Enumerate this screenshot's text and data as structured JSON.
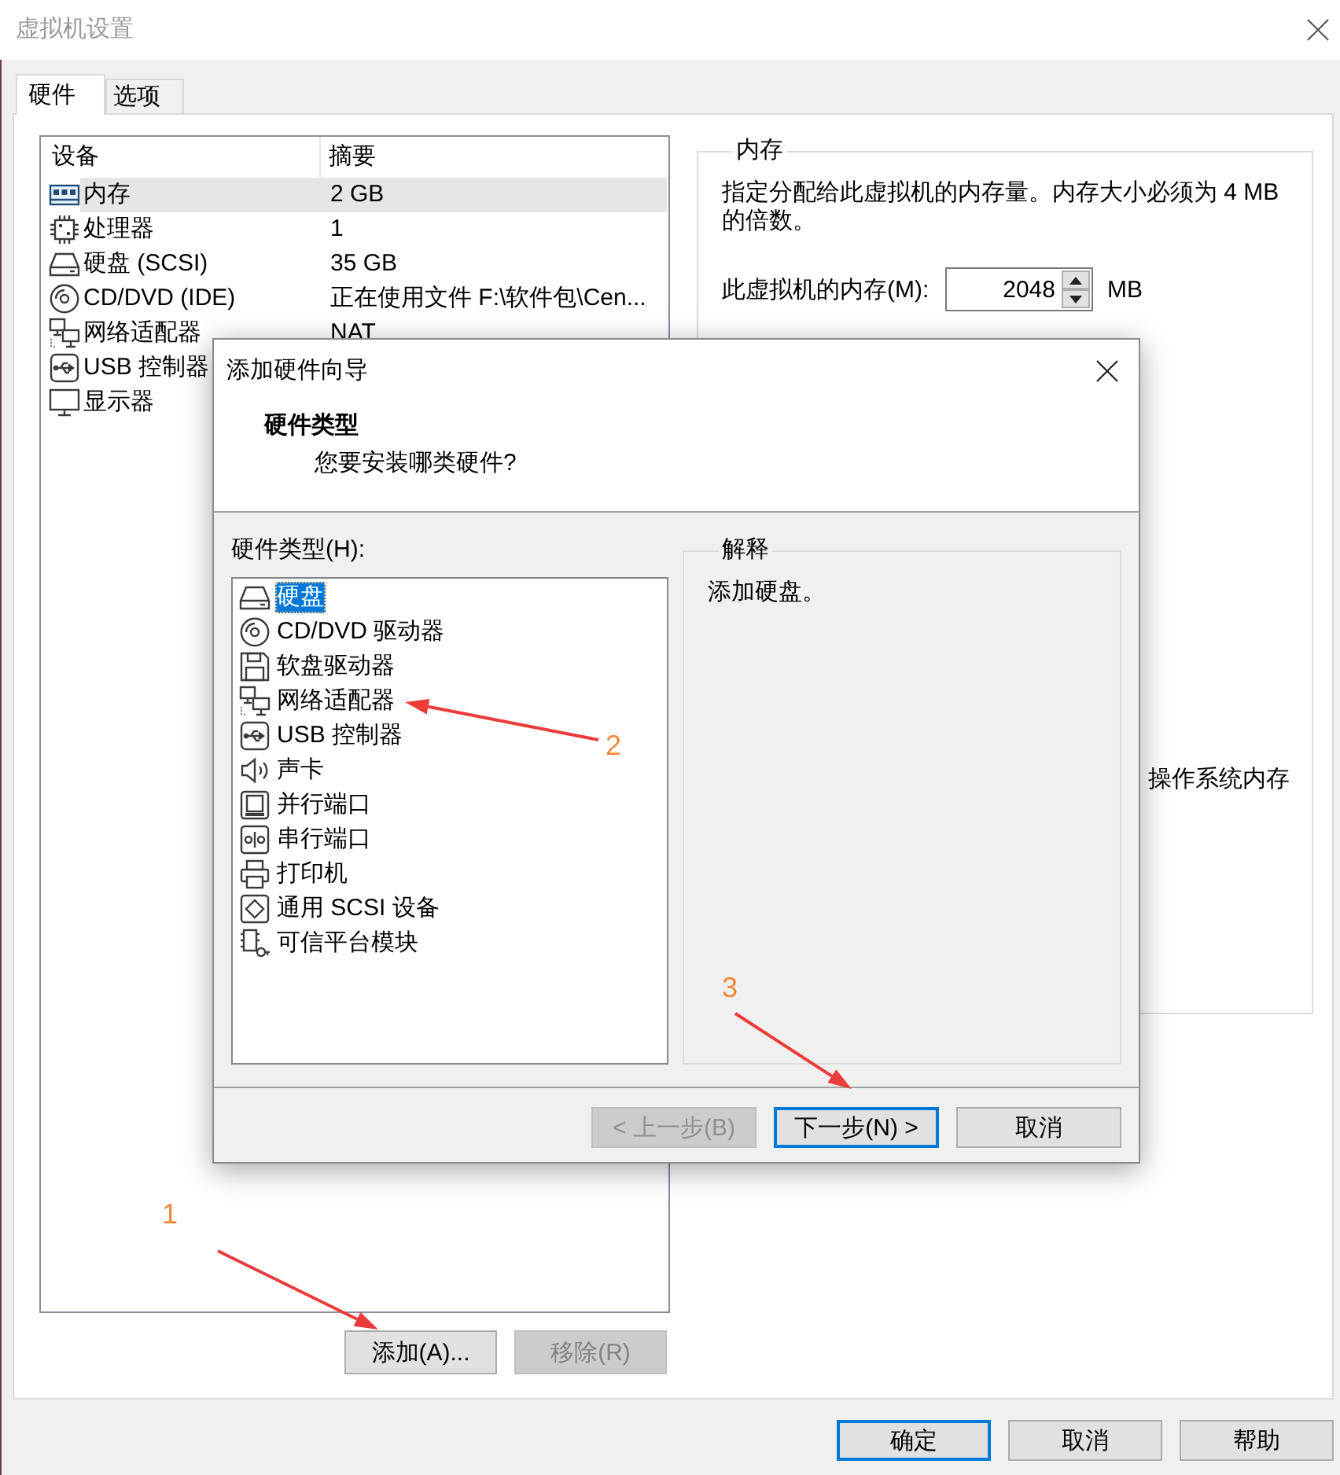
{
  "window": {
    "title": "虚拟机设置"
  },
  "tabs": [
    {
      "label": "硬件",
      "selected": true
    },
    {
      "label": "选项",
      "selected": false
    }
  ],
  "device_list": {
    "columns": [
      "设备",
      "摘要"
    ],
    "rows": [
      {
        "kind": "memory",
        "device": "内存",
        "summary": "2 GB",
        "selected": true
      },
      {
        "kind": "processor",
        "device": "处理器",
        "summary": "1",
        "selected": false
      },
      {
        "kind": "hard_disk",
        "device": "硬盘 (SCSI)",
        "summary": "35 GB",
        "selected": false
      },
      {
        "kind": "cdrom",
        "device": "CD/DVD (IDE)",
        "summary": "正在使用文件 F:\\软件包\\Cen...",
        "selected": false
      },
      {
        "kind": "network",
        "device": "网络适配器",
        "summary": "NAT",
        "selected": false
      },
      {
        "kind": "usb",
        "device": "USB 控制器",
        "selected": false
      },
      {
        "kind": "display",
        "device": "显示器",
        "selected": false
      }
    ]
  },
  "device_buttons": [
    {
      "label": "添加(A)...",
      "disabled": false
    },
    {
      "label": "移除(R)",
      "disabled": true
    }
  ],
  "memory_panel": {
    "title": "内存",
    "description": "指定分配给此虚拟机的内存量。内存大小必须为 4 MB 的倍数。",
    "field_label": "此虚拟机的内存(M):",
    "value": "2048",
    "unit": "MB",
    "partial_text": "操作系统内存"
  },
  "footer_buttons": [
    {
      "label": "确定",
      "default": true
    },
    {
      "label": "取消",
      "default": false
    },
    {
      "label": "帮助",
      "default": false
    }
  ],
  "dialog": {
    "title": "添加硬件向导",
    "heading": "硬件类型",
    "subheading": "您要安装哪类硬件?",
    "list_label": "硬件类型(H):",
    "hardware_types": [
      {
        "kind": "hard_disk",
        "label": "硬盘",
        "selected": true
      },
      {
        "kind": "cdrom",
        "label": "CD/DVD 驱动器",
        "selected": false
      },
      {
        "kind": "floppy",
        "label": "软盘驱动器",
        "selected": false
      },
      {
        "kind": "network",
        "label": "网络适配器",
        "selected": false
      },
      {
        "kind": "usb",
        "label": "USB 控制器",
        "selected": false
      },
      {
        "kind": "sound",
        "label": "声卡",
        "selected": false
      },
      {
        "kind": "parallel",
        "label": "并行端口",
        "selected": false
      },
      {
        "kind": "serial",
        "label": "串行端口",
        "selected": false
      },
      {
        "kind": "printer",
        "label": "打印机",
        "selected": false
      },
      {
        "kind": "scsi",
        "label": "通用 SCSI 设备",
        "selected": false
      },
      {
        "kind": "tpm",
        "label": "可信平台模块",
        "selected": false
      }
    ],
    "explanation": {
      "title": "解释",
      "text": "添加硬盘。"
    },
    "buttons": [
      {
        "label": "< 上一步(B)",
        "disabled": true,
        "default": false
      },
      {
        "label": "下一步(N) >",
        "disabled": false,
        "default": true
      },
      {
        "label": "取消",
        "disabled": false,
        "default": false
      }
    ]
  },
  "annotations": [
    {
      "label": "1"
    },
    {
      "label": "2"
    },
    {
      "label": "3"
    }
  ]
}
